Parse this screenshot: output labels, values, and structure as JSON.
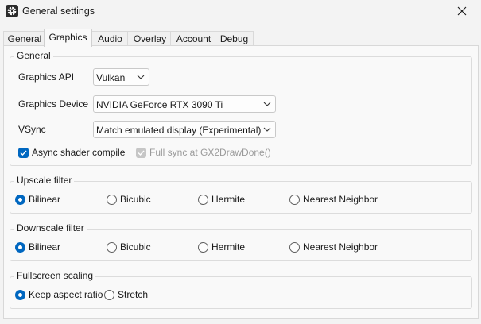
{
  "window": {
    "title": "General settings"
  },
  "tabs": [
    "General",
    "Graphics",
    "Audio",
    "Overlay",
    "Account",
    "Debug"
  ],
  "active_tab": "Graphics",
  "general": {
    "heading": "General",
    "api_label": "Graphics API",
    "api_value": "Vulkan",
    "device_label": "Graphics Device",
    "device_value": "NVIDIA GeForce RTX 3090 Ti",
    "vsync_label": "VSync",
    "vsync_value": "Match emulated display (Experimental)",
    "async_label": "Async shader compile",
    "async_checked": true,
    "fullsync_label": "Full sync at GX2DrawDone()",
    "fullsync_checked": true,
    "fullsync_disabled": true
  },
  "upscale": {
    "heading": "Upscale filter",
    "options": [
      "Bilinear",
      "Bicubic",
      "Hermite",
      "Nearest Neighbor"
    ],
    "selected": "Bilinear"
  },
  "downscale": {
    "heading": "Downscale filter",
    "options": [
      "Bilinear",
      "Bicubic",
      "Hermite",
      "Nearest Neighbor"
    ],
    "selected": "Bilinear"
  },
  "fullscreen": {
    "heading": "Fullscreen scaling",
    "options": [
      "Keep aspect ratio",
      "Stretch"
    ],
    "selected": "Keep aspect ratio"
  },
  "colors": {
    "accent": "#0067c0",
    "background": "#f3f3f3",
    "panel": "#f9f9f9"
  },
  "icons": {
    "app": "gear-icon",
    "close": "close-icon",
    "dropdown": "chevron-down-icon",
    "check": "checkmark-icon"
  }
}
